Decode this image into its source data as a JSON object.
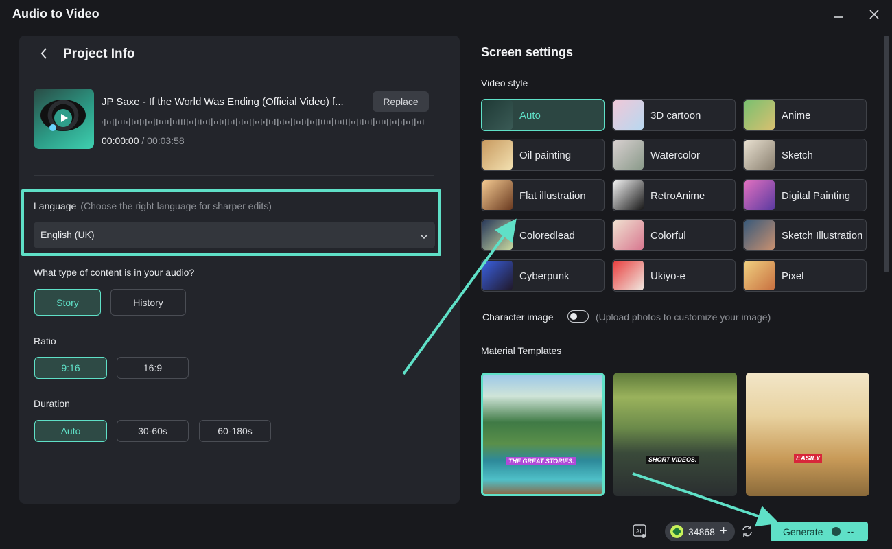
{
  "window": {
    "title": "Audio to Video"
  },
  "project": {
    "title": "Project Info",
    "track_title": "JP Saxe - If the World Was Ending (Official Video) f...",
    "replace_label": "Replace",
    "current_time": "00:00:00",
    "separator": "/",
    "duration": "00:03:58"
  },
  "language": {
    "label": "Language",
    "hint": "(Choose the right language for sharper edits)",
    "selected": "English (UK)"
  },
  "content_type": {
    "question": "What type of content is in your audio?",
    "options": [
      "Story",
      "History"
    ],
    "selected": "Story"
  },
  "ratio": {
    "label": "Ratio",
    "options": [
      "9:16",
      "16:9"
    ],
    "selected": "9:16"
  },
  "duration": {
    "label": "Duration",
    "options": [
      "Auto",
      "30-60s",
      "60-180s"
    ],
    "selected": "Auto"
  },
  "screen_settings": {
    "title": "Screen settings",
    "video_style_label": "Video style",
    "styles": [
      "Auto",
      "3D cartoon",
      "Anime",
      "Oil painting",
      "Watercolor",
      "Sketch",
      "Flat illustration",
      "RetroAnime",
      "Digital Painting",
      "Coloredlead",
      "Colorful",
      "Sketch Illustration",
      "Cyberpunk",
      "Ukiyo-e",
      "Pixel"
    ],
    "selected_style": "Auto",
    "character_image_label": "Character image",
    "character_image_hint": "(Upload photos to customize your image)",
    "character_image_enabled": false,
    "material_templates_label": "Material Templates",
    "templates": [
      {
        "caption": "THE GREAT STORIES.",
        "caption_color": "#b04ad8"
      },
      {
        "caption": "SHORT VIDEOS.",
        "caption_color": "#111111"
      },
      {
        "caption": "EASILY",
        "caption_color": "#d8263a"
      }
    ],
    "selected_template": 0
  },
  "footer": {
    "credits": "34868",
    "credits_plus": "+",
    "generate_label": "Generate",
    "generate_cost": "--"
  },
  "colors": {
    "accent": "#5fe0c7",
    "background": "#18191d",
    "panel": "#23252b"
  }
}
